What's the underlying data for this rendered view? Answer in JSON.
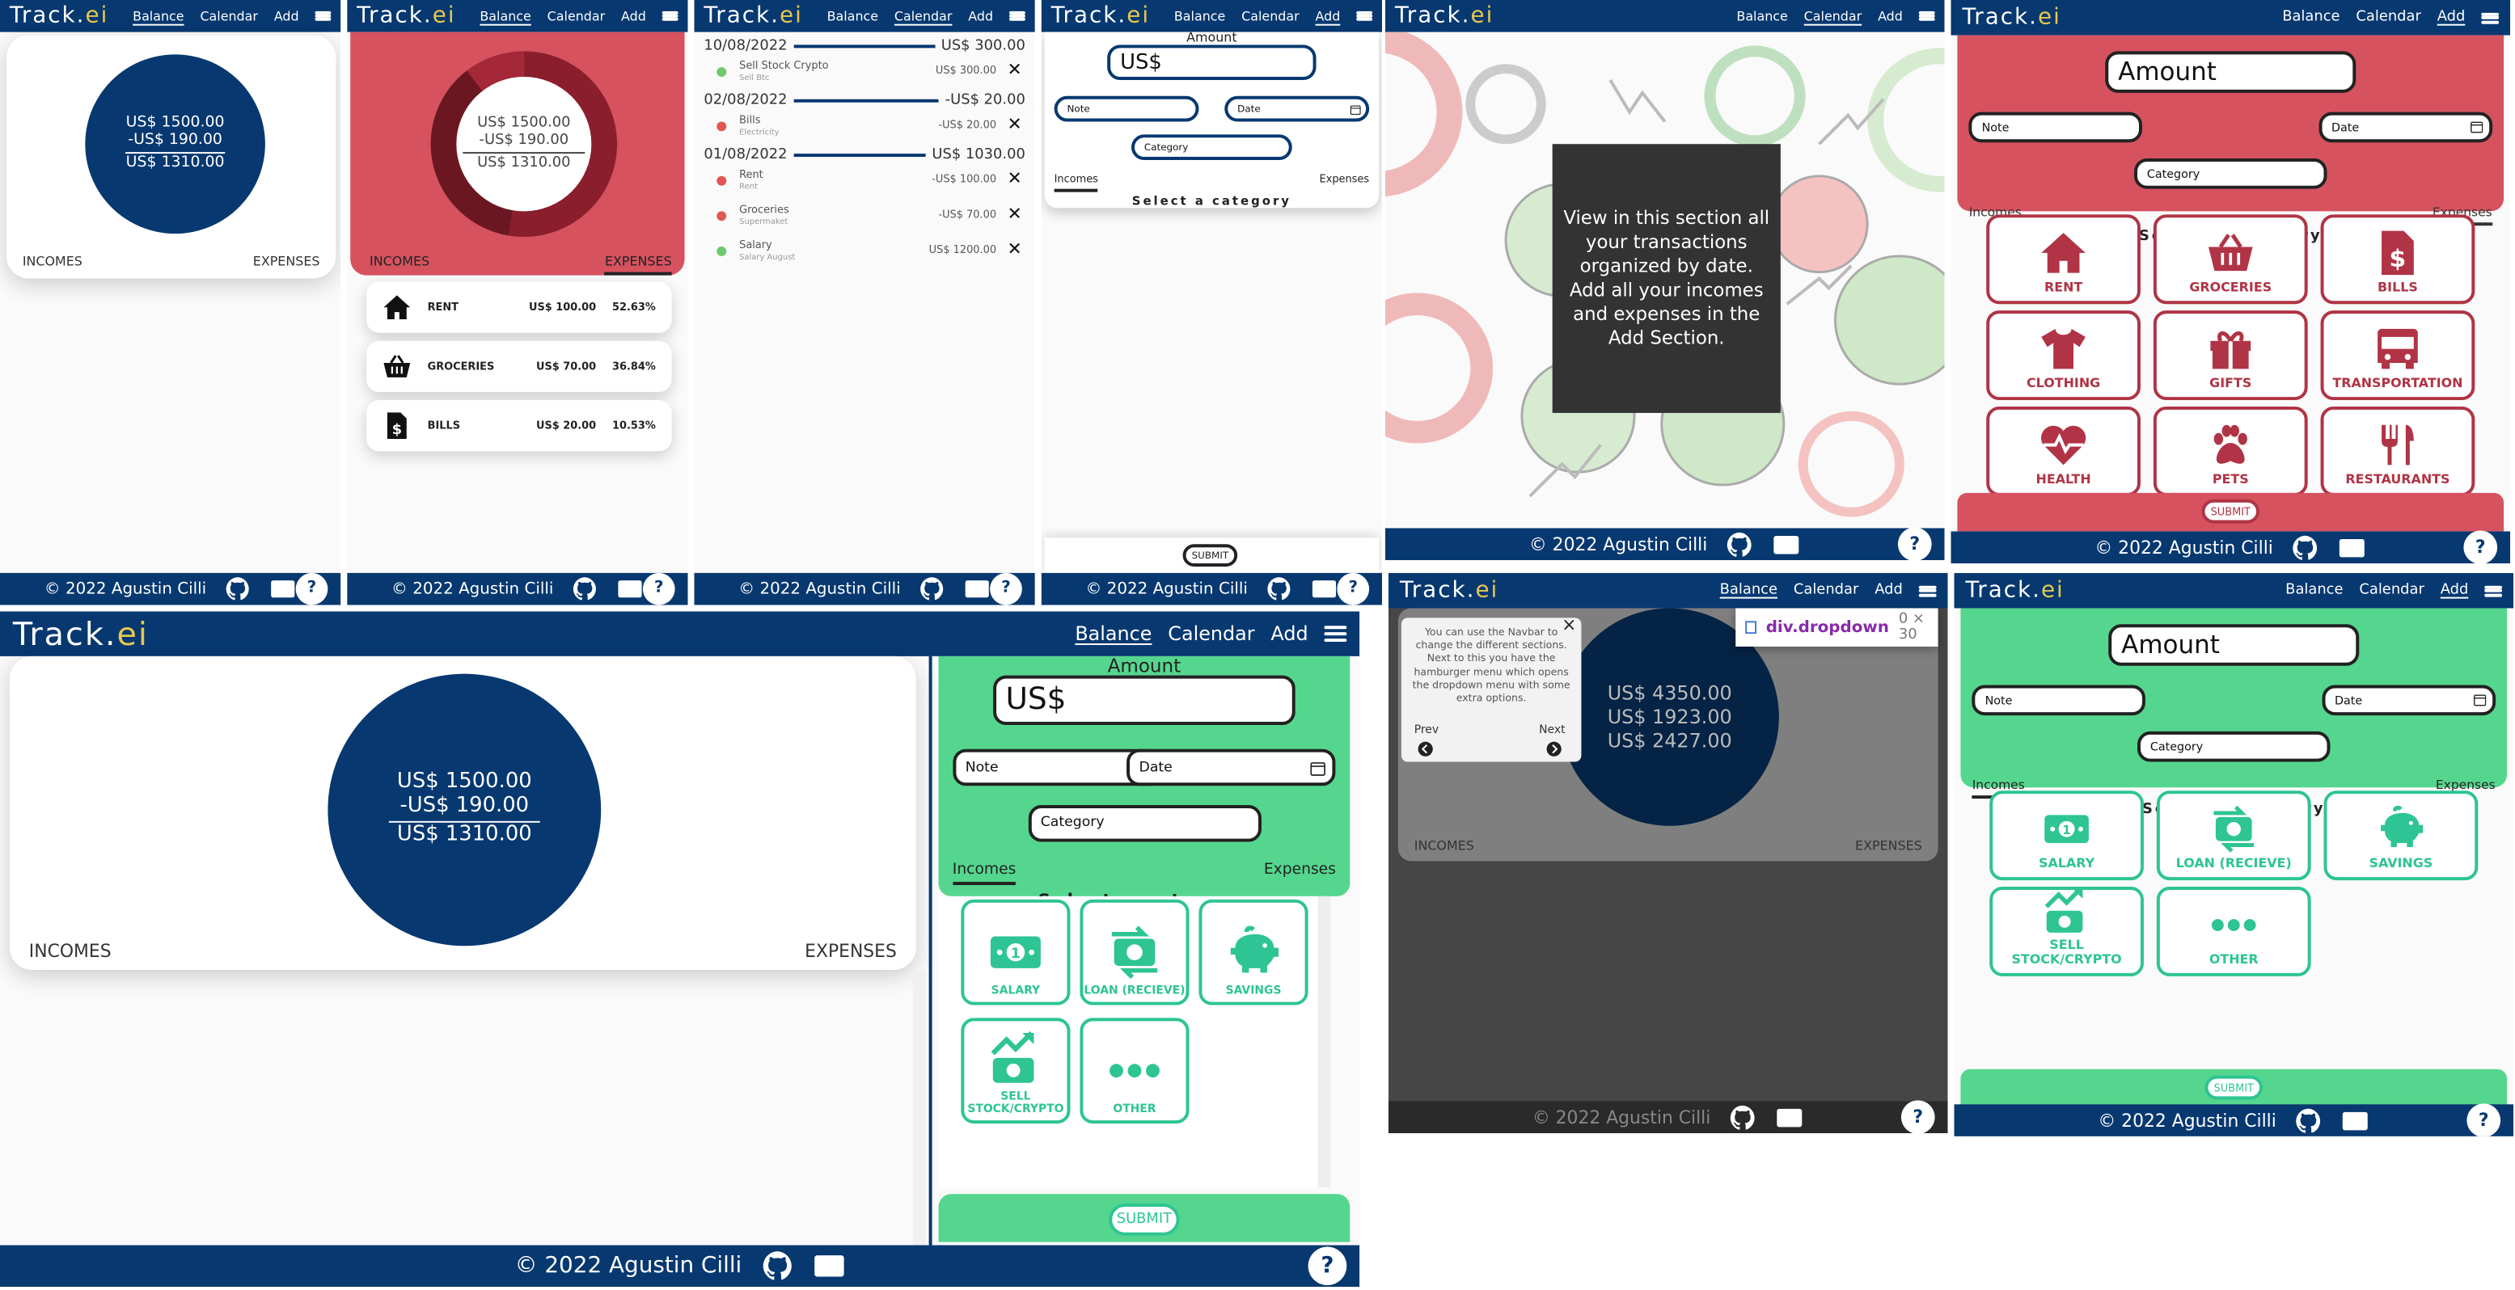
{
  "app": {
    "brand": "Track.",
    "brand_accent": "ei",
    "colors": {
      "navy": "#073870",
      "red": "#d6525f",
      "dark_red": "#b03445",
      "green": "#55d68e",
      "teal": "#2ec494",
      "tooltip_bg": "#333333"
    }
  },
  "nav": {
    "balance": "Balance",
    "calendar": "Calendar",
    "add": "Add"
  },
  "footer": {
    "copyright": "© 2022 Agustin Cilli",
    "help": "?"
  },
  "balance": {
    "income": "US$ 1500.00",
    "expense": "-US$ 190.00",
    "total": "US$ 1310.00",
    "incomes_tab": "INCOMES",
    "expenses_tab": "EXPENSES"
  },
  "expense_breakdown": [
    {
      "icon": "house-icon",
      "name": "RENT",
      "amount": "US$ 100.00",
      "percent": "52.63%",
      "share": 52.63
    },
    {
      "icon": "basket-icon",
      "name": "GROCERIES",
      "amount": "US$ 70.00",
      "percent": "36.84%",
      "share": 36.84
    },
    {
      "icon": "bill-icon",
      "name": "BILLS",
      "amount": "US$ 20.00",
      "percent": "10.53%",
      "share": 10.53
    }
  ],
  "calendar": [
    {
      "date": "10/08/2022",
      "total": "US$ 300.00",
      "items": [
        {
          "title": "Sell Stock Crypto",
          "note": "Sell Btc",
          "amount": "US$ 300.00",
          "kind": "income"
        }
      ]
    },
    {
      "date": "02/08/2022",
      "total": "-US$ 20.00",
      "items": [
        {
          "title": "Bills",
          "note": "Electricity",
          "amount": "-US$ 20.00",
          "kind": "expense"
        }
      ]
    },
    {
      "date": "01/08/2022",
      "total": "US$ 1030.00",
      "items": [
        {
          "title": "Rent",
          "note": "Rent",
          "amount": "-US$ 100.00",
          "kind": "expense"
        },
        {
          "title": "Groceries",
          "note": "Supermaket",
          "amount": "-US$ 70.00",
          "kind": "expense"
        },
        {
          "title": "Salary",
          "note": "Salary August",
          "amount": "US$ 1200.00",
          "kind": "income"
        }
      ]
    }
  ],
  "form": {
    "amount_label": "Amount",
    "amount_value": "US$",
    "amount_placeholder": "Amount",
    "note_placeholder": "Note",
    "date_placeholder": "Date",
    "category_placeholder": "Category",
    "incomes_tab": "Incomes",
    "expenses_tab": "Expenses",
    "select_category": "Select a category",
    "submit": "SUBMIT"
  },
  "expense_categories": [
    {
      "name": "RENT",
      "icon": "house-icon"
    },
    {
      "name": "GROCERIES",
      "icon": "basket-icon"
    },
    {
      "name": "BILLS",
      "icon": "bill-icon"
    },
    {
      "name": "CLOTHING",
      "icon": "shirt-icon"
    },
    {
      "name": "GIFTS",
      "icon": "gift-icon"
    },
    {
      "name": "TRANSPORTATION",
      "icon": "bus-icon"
    },
    {
      "name": "HEALTH",
      "icon": "heart-icon"
    },
    {
      "name": "PETS",
      "icon": "paw-icon"
    },
    {
      "name": "RESTAURANTS",
      "icon": "utensils-icon"
    }
  ],
  "income_categories": [
    {
      "name": "SALARY",
      "icon": "money-icon"
    },
    {
      "name": "LOAN (RECIEVE)",
      "icon": "exchange-money-icon"
    },
    {
      "name": "SAVINGS",
      "icon": "piggy-bank-icon"
    },
    {
      "name": "SELL STOCK/CRYPTO",
      "icon": "stock-up-icon"
    },
    {
      "name": "OTHER",
      "icon": "dots-icon"
    }
  ],
  "calendar_overlay": "View in this section all your transactions organized by date. Add all your incomes and expenses in the Add Section.",
  "tour": {
    "text": "You can use the Navbar to change the different sections. Next to this you have the hamburger menu which opens the dropdown menu with some extra options.",
    "prev": "Prev",
    "next": "Next",
    "close": "×"
  },
  "tour_balance": {
    "income": "US$ 4350.00",
    "expense": "US$ 1923.00",
    "total": "US$ 2427.00"
  },
  "devtools": {
    "selector": "div.dropdown",
    "size": "0 × 30"
  }
}
